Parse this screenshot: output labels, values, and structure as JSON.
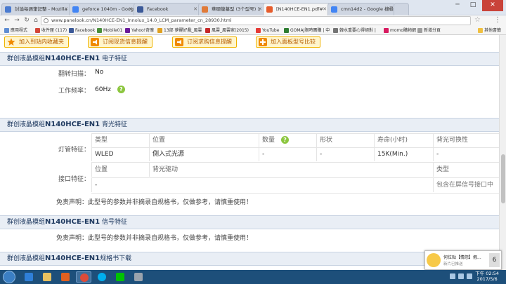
{
  "browser": {
    "tabs": [
      {
        "label": "討論每週筆記整 - Mozilla",
        "color": "#4a7bd0"
      },
      {
        "label": "geforce 1040m - Googl",
        "color": "#4285f4"
      },
      {
        "label": "Facebook",
        "color": "#3b5998"
      },
      {
        "label": "華碩螢幕型 (3个型号) 1",
        "color": "#e07b39"
      },
      {
        "label": "[N140HCE-EN1.pdf#",
        "color": "#e65c2c"
      },
      {
        "label": "cmn14d2 - Google 搜尋",
        "color": "#4285f4"
      }
    ],
    "window_controls": {
      "minimize": "─",
      "maximize": "□",
      "close": "✕"
    },
    "url": "www.panelook.cn/N140HCE-EN1_Innolux_14.0_LCM_parameter_cn_28930.html",
    "bookmarks": [
      {
        "label": "應用程式",
        "color": "#5f8dd3"
      },
      {
        "label": "收件匣 (117)",
        "color": "#d44638"
      },
      {
        "label": "Facebook",
        "color": "#3b5998"
      },
      {
        "label": "Mobile01",
        "color": "#4a8f3a"
      },
      {
        "label": "Yahoo!奇摩",
        "color": "#6a1b9a"
      },
      {
        "label": "13部 夢醒好戲_風雲",
        "color": "#e0a020"
      },
      {
        "label": "風雲_風雲家(2015)",
        "color": "#c62828"
      },
      {
        "label": "YouTube",
        "color": "#e53935"
      },
      {
        "label": "GOMAJ限時團購 | 中",
        "color": "#2e7d32"
      },
      {
        "label": "韓水重要心得絕對 |",
        "color": "#757575"
      },
      {
        "label": "momo購物網",
        "color": "#d81b60"
      },
      {
        "label": "新增分頁",
        "color": "#9e9e9e"
      }
    ],
    "other_bookmarks": "其他書籤"
  },
  "actions": [
    {
      "label": "加入到站内收藏夹",
      "icon": "star-icon"
    },
    {
      "label": "订阅现货信息提醒",
      "icon": "megaphone-icon"
    },
    {
      "label": "订阅求购信息提醒",
      "icon": "megaphone-icon"
    },
    {
      "label": "加入面板型号比较",
      "icon": "plus-icon"
    }
  ],
  "electrical": {
    "title_prefix": "群创液晶模组",
    "model": "N140HCE-EN1",
    "title_suffix": " 电子特征",
    "rows": [
      {
        "label": "翻转扫描：",
        "value": "No"
      },
      {
        "label": "工作频率：",
        "value": "60Hz"
      }
    ]
  },
  "backlight": {
    "title_prefix": "群创液晶模组",
    "model": "N140HCE-EN1",
    "title_suffix": " 背光特征",
    "lamp_label": "灯管特征：",
    "lamp_headers": [
      "类型",
      "位置",
      "数量",
      "形状",
      "寿命(小时)",
      "背光可换性"
    ],
    "lamp_values": [
      "WLED",
      "側入式光源",
      "-",
      "-",
      "15K(Min.)",
      "-"
    ],
    "port_label": "接口特征：",
    "port_headers": [
      "位置",
      "背光驱动",
      "类型"
    ],
    "port_values": [
      "-",
      "",
      "包含在屏信号接口中"
    ],
    "disclaimer": "免责声明：此型号的参数并非摘录自规格书，仅做参考，请慎重使用！"
  },
  "signal": {
    "title_prefix": "群创液晶模组",
    "model": "N140HCE-EN1",
    "title_suffix": " 信号特征",
    "disclaimer": "免责声明：此型号的参数并非摘录自规格书，仅做参考，请慎重使用！"
  },
  "download": {
    "title_prefix": "群创液晶模组",
    "model": "N140HCE-EN1",
    "title_suffix": "规格书下载"
  },
  "popup": {
    "title": "何位贴【情怨】假...",
    "subtitle": "新片已推送",
    "badge": "6"
  },
  "taskbar": {
    "time": "下午 02:54",
    "date": "2017/5/6"
  }
}
